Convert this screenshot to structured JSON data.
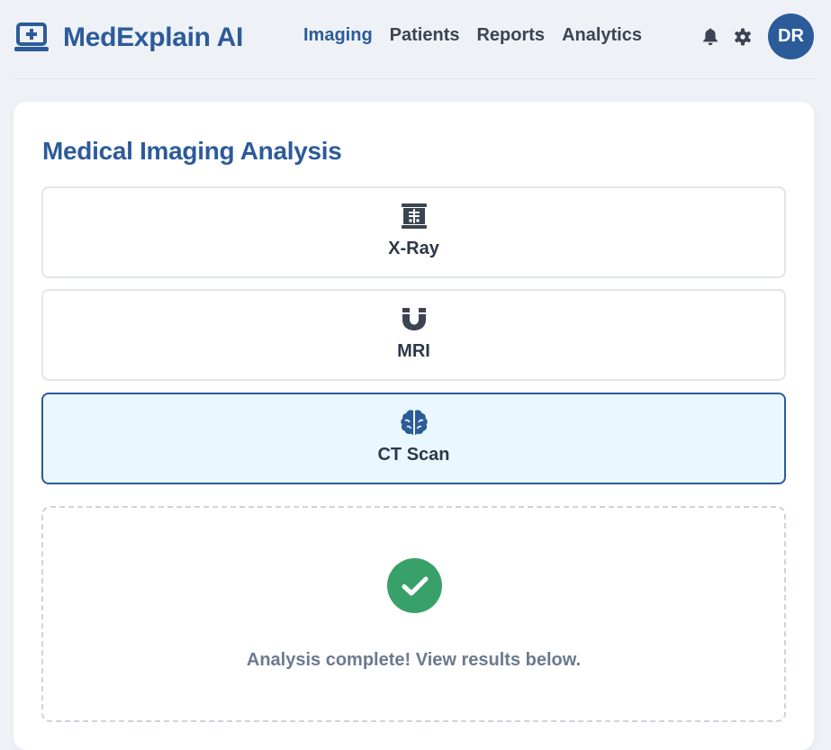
{
  "app": {
    "title": "MedExplain AI",
    "logo_icon": "laptop-medical-icon"
  },
  "nav": {
    "items": [
      {
        "label": "Imaging",
        "active": true
      },
      {
        "label": "Patients",
        "active": false
      },
      {
        "label": "Reports",
        "active": false
      },
      {
        "label": "Analytics",
        "active": false
      }
    ]
  },
  "header": {
    "notification_icon": "bell-icon",
    "settings_icon": "gear-icon",
    "avatar_initials": "DR"
  },
  "main": {
    "title": "Medical Imaging Analysis",
    "options": [
      {
        "label": "X-Ray",
        "icon": "x-ray-icon",
        "selected": false
      },
      {
        "label": "MRI",
        "icon": "magnet-icon",
        "selected": false
      },
      {
        "label": "CT Scan",
        "icon": "brain-icon",
        "selected": true
      }
    ],
    "result": {
      "status_icon": "check-circle-icon",
      "message": "Analysis complete! View results below."
    }
  },
  "colors": {
    "brand": "#2c5b9a",
    "success": "#38a169",
    "selected_bg": "#ebf7fe",
    "page_bg": "#eef2f7"
  }
}
